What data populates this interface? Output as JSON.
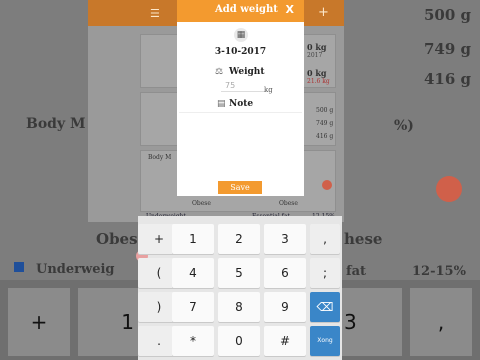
{
  "background": {
    "left_texts": [
      "Body M",
      "Obese"
    ],
    "right_texts": [
      "500 g",
      "749 g",
      "416 g",
      "%)",
      "hese"
    ],
    "underweight": "Underweig",
    "fat": "fat",
    "fat_range": "12-15%",
    "mid_values": [
      "0 kg",
      "2017",
      "0 kg",
      "21.6 kg",
      "500 g",
      "749 g",
      "416 g"
    ],
    "mid_labels": [
      "Body M",
      "Obese",
      "Obese",
      "Underweight",
      "Essential fat",
      "12-15%"
    ]
  },
  "dialog": {
    "title": "Add weight",
    "close": "X",
    "date": "3-10-2017",
    "weight_label": "Weight",
    "weight_value": "75",
    "unit": "kg",
    "note_label": "Note",
    "save_label": "Save"
  },
  "keyboard": {
    "rows": [
      [
        "+",
        "1",
        "2",
        "3",
        ","
      ],
      [
        "(",
        "4",
        "5",
        "6",
        ";"
      ],
      [
        ")",
        "7",
        "8",
        "9",
        "⌫"
      ],
      [
        ".",
        "*",
        "0",
        "#",
        "Xong"
      ]
    ]
  },
  "side_keyboard": {
    "left": [
      "+",
      "1"
    ],
    "right": [
      "3",
      ","
    ]
  },
  "colors": {
    "accent": "#f39a2f",
    "key_blue": "#3a86c8"
  }
}
